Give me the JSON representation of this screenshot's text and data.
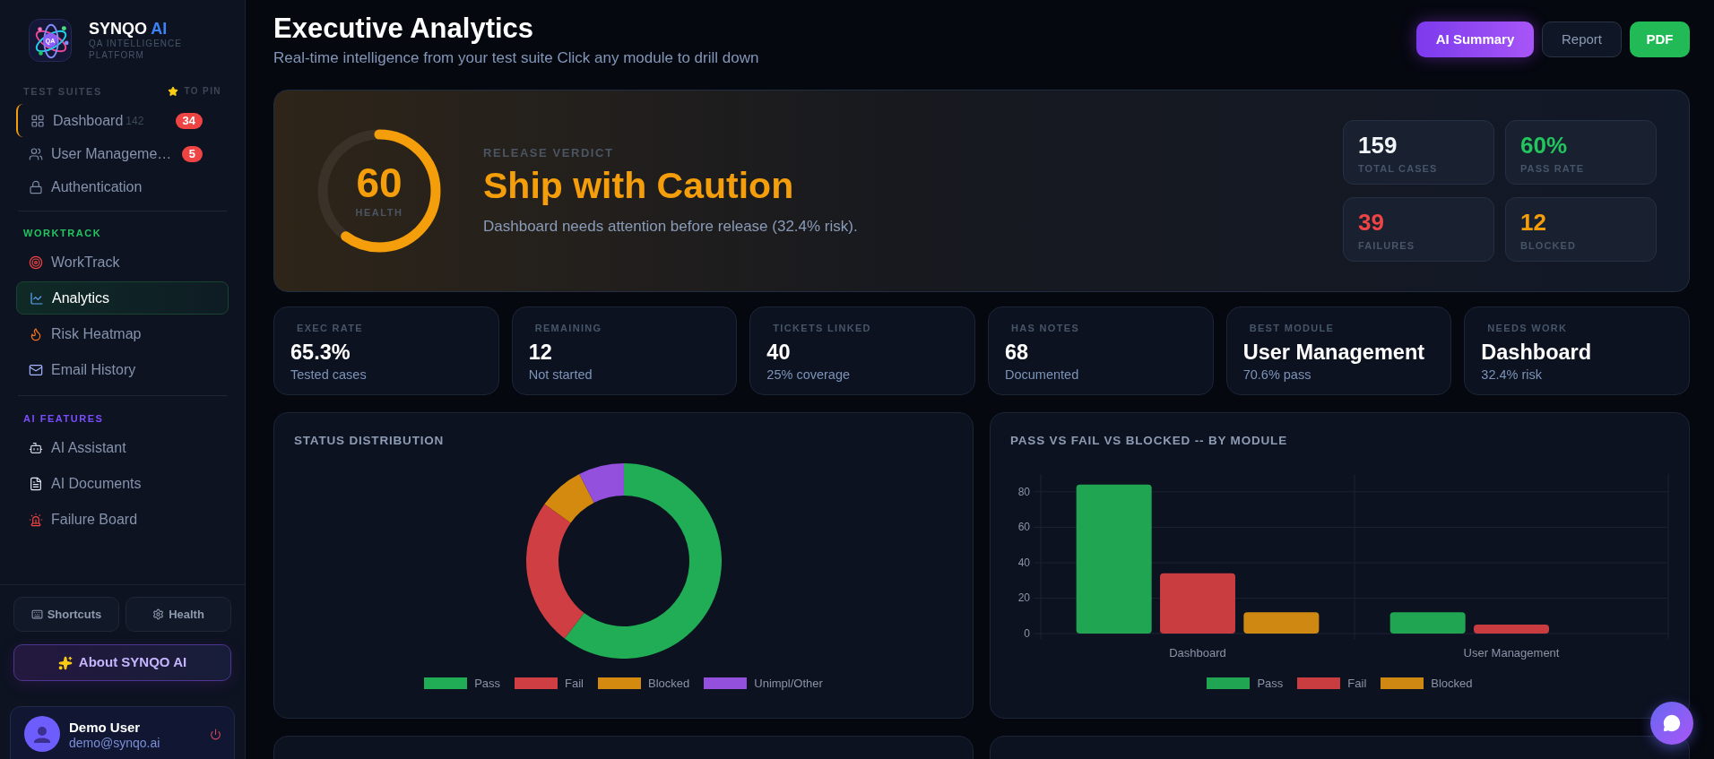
{
  "sidebar": {
    "brand": {
      "logo_text": "QA",
      "name": "SYNQO",
      "name_accent": "AI",
      "tagline": "QA INTELLIGENCE PLATFORM"
    },
    "sections": [
      {
        "title": "TEST SUITES",
        "color": "#3d4757",
        "hint": "TO PIN",
        "items": [
          {
            "label": "Dashboard",
            "count": "142",
            "badge": "34",
            "highlighted": true,
            "selected": false
          },
          {
            "label": "User Manageme…",
            "badge": "5",
            "highlighted": false,
            "selected": false
          },
          {
            "label": "Authentication",
            "highlighted": false,
            "selected": false
          }
        ]
      },
      {
        "title": "WORKTRACK",
        "color": "#22c55e",
        "items": [
          {
            "label": "WorkTrack",
            "selected": false
          },
          {
            "label": "Analytics",
            "selected": true
          },
          {
            "label": "Risk Heatmap",
            "selected": false
          },
          {
            "label": "Email History",
            "selected": false
          }
        ]
      },
      {
        "title": "AI FEATURES",
        "color": "#7c4dff",
        "items": [
          {
            "label": "AI Assistant",
            "selected": false
          },
          {
            "label": "AI Documents",
            "selected": false
          },
          {
            "label": "Failure Board",
            "selected": false
          }
        ]
      }
    ],
    "tools": [
      {
        "label": "Shortcuts"
      },
      {
        "label": "Health"
      }
    ],
    "about": {
      "label": "About SYNQO AI"
    },
    "user": {
      "name": "Demo User",
      "email": "demo@synqo.ai"
    }
  },
  "header": {
    "title": "Executive Analytics",
    "subtitle": "Real-time intelligence from your test suite Click any module to drill down",
    "actions": [
      {
        "label": "AI Summary",
        "kind": "ai"
      },
      {
        "label": "Report",
        "kind": "outline"
      },
      {
        "label": "PDF",
        "kind": "export"
      }
    ]
  },
  "verdict": {
    "warning": true,
    "health": {
      "value": "60",
      "label": "HEALTH",
      "level": 0.6
    },
    "eyebrow": "RELEASE VERDICT",
    "headline": "Ship with Caution",
    "summary": "Dashboard needs attention before release (32.4% risk).",
    "stats": [
      {
        "value": "159",
        "label": "TOTAL CASES",
        "color": "#f1f5f9"
      },
      {
        "value": "60%",
        "label": "PASS RATE",
        "color": "#22c55e"
      },
      {
        "value": "39",
        "label": "FAILURES",
        "color": "#ef4444"
      },
      {
        "value": "12",
        "label": "BLOCKED",
        "color": "#f59e0b"
      }
    ]
  },
  "metrics": [
    {
      "label": "EXEC RATE",
      "value": "65.3%",
      "note": "Tested cases"
    },
    {
      "label": "REMAINING",
      "value": "12",
      "note": "Not started"
    },
    {
      "label": "TICKETS LINKED",
      "value": "40",
      "note": "25% coverage"
    },
    {
      "label": "HAS NOTES",
      "value": "68",
      "note": "Documented"
    },
    {
      "label": "BEST MODULE",
      "value": "User Management",
      "note": "70.6% pass"
    },
    {
      "label": "NEEDS WORK",
      "value": "Dashboard",
      "note": "32.4% risk"
    }
  ],
  "charts": [
    {
      "title": "STATUS DISTRIBUTION",
      "chart_data": {
        "type": "donut",
        "categories": [
          "Pass",
          "Fail",
          "Blocked",
          "Unimpl/Other"
        ],
        "values": [
          60.4,
          24.5,
          7.55,
          7.55
        ],
        "colors": [
          "#20ad55",
          "#cf3e42",
          "#d48a0e",
          "#9350dc"
        ]
      }
    },
    {
      "title": "PASS VS FAIL VS BLOCKED -- BY MODULE",
      "chart_data": {
        "type": "bar",
        "categories": [
          "Dashboard",
          "User Management"
        ],
        "series": [
          {
            "name": "Pass",
            "color": "#20a652",
            "values": [
              84,
              12
            ]
          },
          {
            "name": "Fail",
            "color": "#c93c40",
            "values": [
              34,
              5
            ]
          },
          {
            "name": "Blocked",
            "color": "#cf8912",
            "values": [
              12,
              0
            ]
          }
        ],
        "ylim": [
          0,
          90
        ],
        "yticks": [
          0,
          20,
          40,
          60,
          80
        ],
        "grid": true
      }
    }
  ]
}
